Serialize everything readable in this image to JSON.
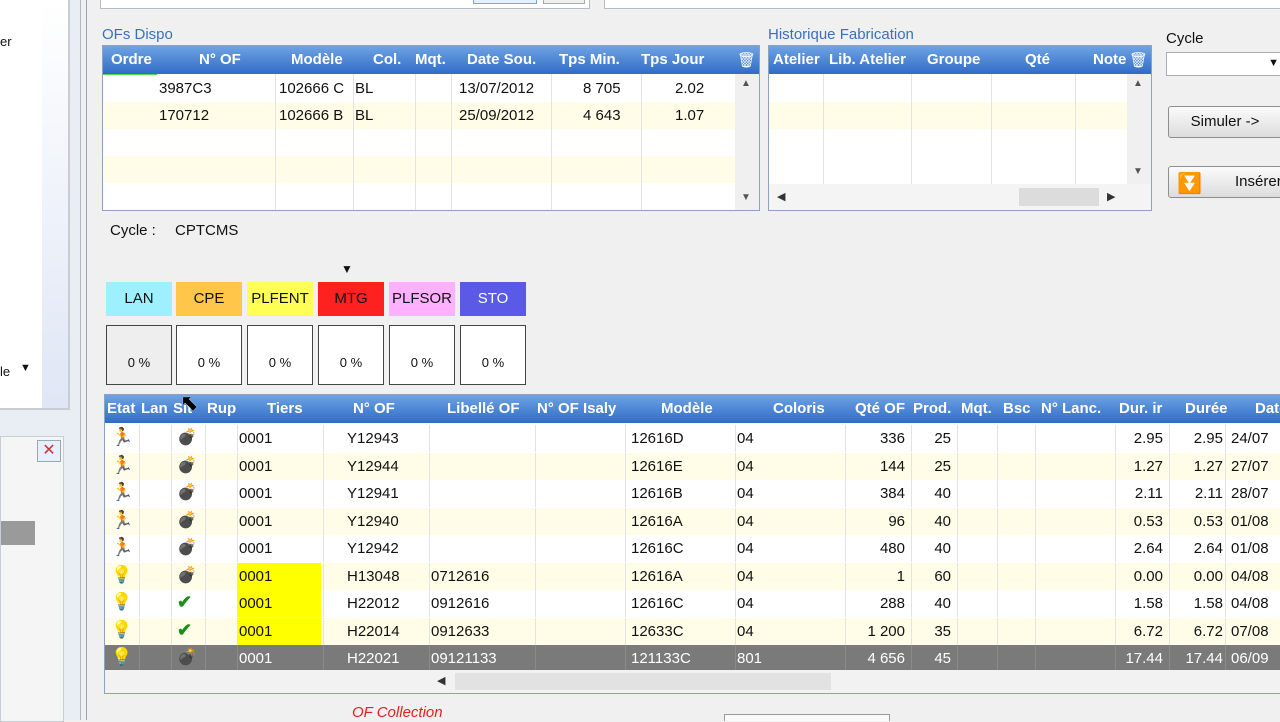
{
  "left_panel": {
    "item_label": "er",
    "item_label2": "le",
    "close_label": "✕"
  },
  "ofs_dispo": {
    "title": "OFs Dispo",
    "columns": [
      "Ordre",
      "N° OF",
      "Modèle",
      "Col.",
      "Mqt.",
      "Date Sou.",
      "Tps Min.",
      "Tps Jour"
    ],
    "rows": [
      {
        "n_of": "3987C3",
        "modele": "102666 C",
        "col": "BL",
        "mqt": "",
        "date": "13/07/2012",
        "tps_min": "8 705",
        "tps_jour": "2.02"
      },
      {
        "n_of": "170712",
        "modele": "102666 B",
        "col": "BL",
        "mqt": "",
        "date": "25/09/2012",
        "tps_min": "4 643",
        "tps_jour": "1.07"
      }
    ]
  },
  "historique": {
    "title": "Historique Fabrication",
    "columns": [
      "Atelier",
      "Lib. Atelier",
      "Groupe",
      "Qté",
      "Note"
    ]
  },
  "right": {
    "cycle_label": "Cycle",
    "simuler": "Simuler ->",
    "inserer": "Insérer"
  },
  "cycle": {
    "label": "Cycle :",
    "value": "CPTCMS"
  },
  "steps": [
    {
      "code": "LAN",
      "color": "#9ff0ff",
      "pct": "0 %"
    },
    {
      "code": "CPE",
      "color": "#ffc64a",
      "pct": "0 %"
    },
    {
      "code": "PLFENT",
      "color": "#ffff55",
      "pct": "0 %"
    },
    {
      "code": "MTG",
      "color": "#ff2020",
      "pct": "0 %"
    },
    {
      "code": "PLFSOR",
      "color": "#ffb0ff",
      "pct": "0 %"
    },
    {
      "code": "STO",
      "color": "#5a5ae6",
      "pct": "0 %"
    }
  ],
  "of_grid": {
    "columns": [
      "Etat",
      "Lan",
      "Sit",
      "Rup",
      "Tiers",
      "N° OF",
      "Libellé OF",
      "N° OF Isaly",
      "Modèle",
      "Coloris",
      "Qté OF",
      "Prod.",
      "Mqt.",
      "Bsc",
      "N° Lanc.",
      "Dur. ir",
      "Durée",
      "Date"
    ],
    "rows": [
      {
        "etat": "walk",
        "sit": "bomb",
        "tiers": "0001",
        "tiers_hl": false,
        "n_of": "Y12943",
        "libelle": "",
        "modele": "12616D",
        "coloris": "04",
        "qte": "336",
        "prod": "25",
        "dur": "2.95",
        "duree": "2.95",
        "date": "24/07",
        "selected": false
      },
      {
        "etat": "walk",
        "sit": "bomb",
        "tiers": "0001",
        "tiers_hl": false,
        "n_of": "Y12944",
        "libelle": "",
        "modele": "12616E",
        "coloris": "04",
        "qte": "144",
        "prod": "25",
        "dur": "1.27",
        "duree": "1.27",
        "date": "27/07",
        "selected": false
      },
      {
        "etat": "walk",
        "sit": "bomb",
        "tiers": "0001",
        "tiers_hl": false,
        "n_of": "Y12941",
        "libelle": "",
        "modele": "12616B",
        "coloris": "04",
        "qte": "384",
        "prod": "40",
        "dur": "2.11",
        "duree": "2.11",
        "date": "28/07",
        "selected": false
      },
      {
        "etat": "walk",
        "sit": "bomb",
        "tiers": "0001",
        "tiers_hl": false,
        "n_of": "Y12940",
        "libelle": "",
        "modele": "12616A",
        "coloris": "04",
        "qte": "96",
        "prod": "40",
        "dur": "0.53",
        "duree": "0.53",
        "date": "01/08",
        "selected": false
      },
      {
        "etat": "walk",
        "sit": "bomb",
        "tiers": "0001",
        "tiers_hl": false,
        "n_of": "Y12942",
        "libelle": "",
        "modele": "12616C",
        "coloris": "04",
        "qte": "480",
        "prod": "40",
        "dur": "2.64",
        "duree": "2.64",
        "date": "01/08",
        "selected": false
      },
      {
        "etat": "bulb",
        "sit": "bomb",
        "tiers": "0001",
        "tiers_hl": true,
        "n_of": "H13048",
        "libelle": "0712616",
        "modele": "12616A",
        "coloris": "04",
        "qte": "1",
        "prod": "60",
        "dur": "0.00",
        "duree": "0.00",
        "date": "04/08",
        "selected": false
      },
      {
        "etat": "bulb",
        "sit": "check",
        "tiers": "0001",
        "tiers_hl": true,
        "n_of": "H22012",
        "libelle": "0912616",
        "modele": "12616C",
        "coloris": "04",
        "qte": "288",
        "prod": "40",
        "dur": "1.58",
        "duree": "1.58",
        "date": "04/08",
        "selected": false
      },
      {
        "etat": "bulb",
        "sit": "check",
        "tiers": "0001",
        "tiers_hl": true,
        "n_of": "H22014",
        "libelle": "0912633",
        "modele": "12633C",
        "coloris": "04",
        "qte": "1 200",
        "prod": "35",
        "dur": "6.72",
        "duree": "6.72",
        "date": "07/08",
        "selected": false
      },
      {
        "etat": "bulb",
        "sit": "bomb",
        "tiers": "0001",
        "tiers_hl": false,
        "n_of": "H22021",
        "libelle": "09121133",
        "modele": "121133C",
        "coloris": "801",
        "qte": "4 656",
        "prod": "45",
        "dur": "17.44",
        "duree": "17.44",
        "date": "06/09",
        "selected": true
      }
    ]
  },
  "footer": {
    "caption": "OF Collection"
  }
}
